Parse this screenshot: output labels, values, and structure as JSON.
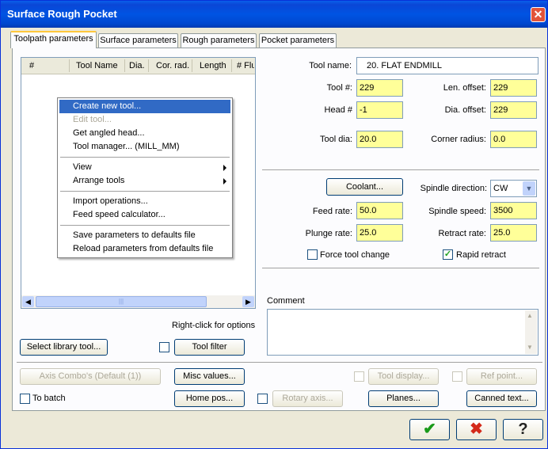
{
  "window": {
    "title": "Surface Rough Pocket"
  },
  "tabs": [
    {
      "label": "Toolpath parameters"
    },
    {
      "label": "Surface parameters"
    },
    {
      "label": "Rough parameters"
    },
    {
      "label": "Pocket parameters"
    }
  ],
  "tool_list": {
    "columns": [
      "#",
      "Tool Name",
      "Dia.",
      "Cor. rad.",
      "Length",
      "# Flu"
    ],
    "hint": "Right-click for options"
  },
  "context_menu": {
    "items": [
      {
        "label": "Create new tool..."
      },
      {
        "label": "Edit tool..."
      },
      {
        "label": "Get angled head..."
      },
      {
        "label": "Tool manager...",
        "detail": "(MILL_MM)"
      },
      {
        "label": "View"
      },
      {
        "label": "Arrange tools"
      },
      {
        "label": "Import operations..."
      },
      {
        "label": "Feed speed calculator..."
      },
      {
        "label": "Save parameters to defaults file"
      },
      {
        "label": "Reload parameters from defaults file"
      }
    ]
  },
  "tool": {
    "name_label": "Tool name:",
    "name_value": "20. FLAT ENDMILL",
    "num_label": "Tool #:",
    "num_value": "229",
    "len_offset_label": "Len. offset:",
    "len_offset_value": "229",
    "head_label": "Head #",
    "head_value": "-1",
    "dia_offset_label": "Dia. offset:",
    "dia_offset_value": "229",
    "dia_label": "Tool dia:",
    "dia_value": "20.0",
    "corner_label": "Corner radius:",
    "corner_value": "0.0"
  },
  "params": {
    "coolant_label": "Coolant...",
    "spindle_dir_label": "Spindle direction:",
    "spindle_dir_value": "CW",
    "feed_label": "Feed rate:",
    "feed_value": "50.0",
    "spindle_speed_label": "Spindle speed:",
    "spindle_speed_value": "3500",
    "plunge_label": "Plunge rate:",
    "plunge_value": "25.0",
    "retract_label": "Retract rate:",
    "retract_value": "25.0",
    "force_tool_change_label": "Force tool change",
    "rapid_retract_label": "Rapid retract",
    "rapid_retract_checked": true
  },
  "comment": {
    "label": "Comment"
  },
  "buttons": {
    "select_library": "Select library tool...",
    "tool_filter": "Tool filter",
    "axis_combo": "Axis Combo's (Default (1))",
    "misc_values": "Misc values...",
    "tool_display": "Tool display...",
    "ref_point": "Ref point...",
    "to_batch": "To batch",
    "home_pos": "Home pos...",
    "rotary_axis": "Rotary axis...",
    "planes": "Planes...",
    "canned_text": "Canned text..."
  },
  "dialog_buttons": {
    "ok": "✔",
    "cancel": "✖",
    "help": "?"
  },
  "colors": {
    "title_bar": "#0054e3",
    "input_highlight": "#ffff99",
    "menu_highlight": "#316ac5",
    "ok_green": "#1a9a1a",
    "cancel_red": "#d42a1a"
  }
}
